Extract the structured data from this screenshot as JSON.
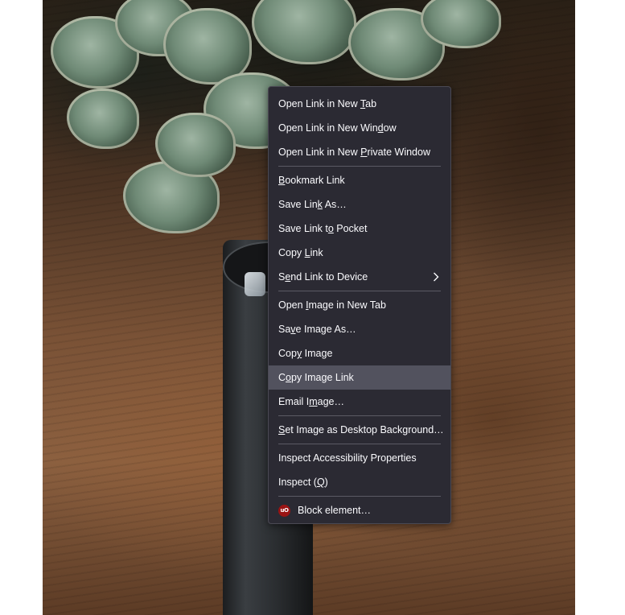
{
  "menu": {
    "items": [
      {
        "pre": "Open Link in New ",
        "acc": "T",
        "post": "ab"
      },
      {
        "pre": "Open Link in New Win",
        "acc": "d",
        "post": "ow"
      },
      {
        "pre": "Open Link in New ",
        "acc": "P",
        "post": "rivate Window"
      },
      {
        "pre": "",
        "acc": "B",
        "post": "ookmark Link"
      },
      {
        "pre": "Save Lin",
        "acc": "k",
        "post": " As…"
      },
      {
        "pre": "Save Link t",
        "acc": "o",
        "post": " Pocket"
      },
      {
        "pre": "Copy ",
        "acc": "L",
        "post": "ink"
      },
      {
        "pre": "S",
        "acc": "e",
        "post": "nd Link to Device"
      },
      {
        "pre": "Open ",
        "acc": "I",
        "post": "mage in New Tab"
      },
      {
        "pre": "Sa",
        "acc": "v",
        "post": "e Image As…"
      },
      {
        "pre": "Cop",
        "acc": "y",
        "post": " Image"
      },
      {
        "pre": "C",
        "acc": "o",
        "post": "py Image Link"
      },
      {
        "pre": "Email I",
        "acc": "m",
        "post": "age…"
      },
      {
        "pre": "",
        "acc": "S",
        "post": "et Image as Desktop Background…"
      },
      {
        "pre": "Inspect Accessibility Properties",
        "acc": "",
        "post": ""
      },
      {
        "pre": "Inspect (",
        "acc": "Q",
        "post": ")"
      },
      {
        "pre": "Block element…",
        "acc": "",
        "post": ""
      }
    ],
    "ublock_icon_text": "uO",
    "ublock_icon": "ublock-origin-icon",
    "submenu_icon": "chevron-right-icon",
    "highlighted_item": "Copy Image Link"
  },
  "colors": {
    "menu_background": "#2b2a33",
    "menu_highlight": "#52525e",
    "menu_text": "#fbfbfe",
    "ublock_red": "#9a1414"
  }
}
